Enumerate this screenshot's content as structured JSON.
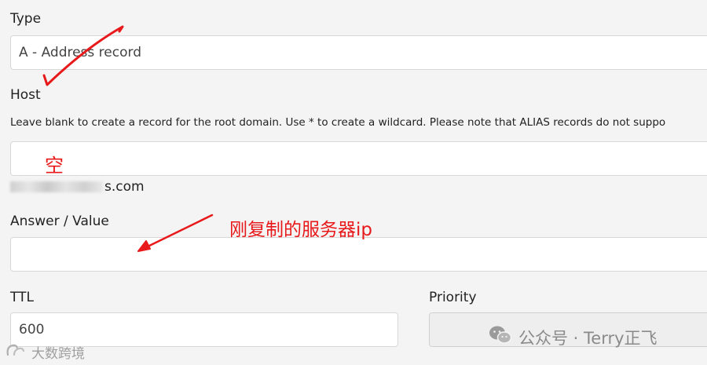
{
  "form": {
    "type": {
      "label": "Type",
      "value": "A - Address record"
    },
    "host": {
      "label": "Host",
      "help": "Leave blank to create a record for the root domain. Use * to create a wildcard. Please note that ALIAS records do not suppo",
      "value": "",
      "domain_suffix": "s.com"
    },
    "answer": {
      "label": "Answer / Value",
      "value": ""
    },
    "ttl": {
      "label": "TTL",
      "value": "600"
    },
    "priority": {
      "label": "Priority",
      "value": ""
    }
  },
  "annotations": {
    "host_note": "空",
    "answer_note": "刚复制的服务器ip",
    "color": "#e8191b"
  },
  "watermarks": {
    "right": "公众号 · Terry正飞",
    "left": "大数跨境"
  }
}
